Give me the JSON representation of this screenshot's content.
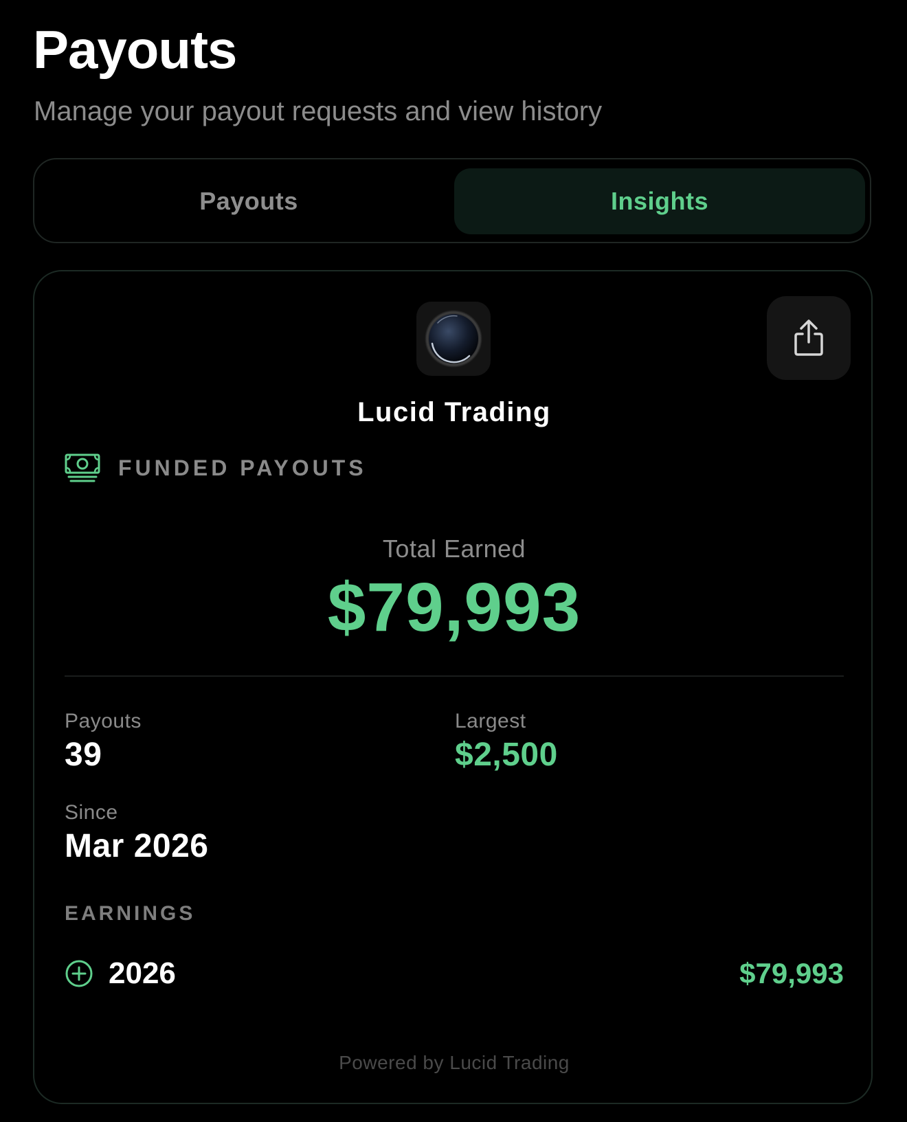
{
  "header": {
    "title": "Payouts",
    "subtitle": "Manage your payout requests and view history"
  },
  "tabs": [
    {
      "label": "Payouts",
      "active": false
    },
    {
      "label": "Insights",
      "active": true
    }
  ],
  "card": {
    "logo_icon": "moon-orb-logo",
    "share_icon": "share-icon",
    "brand_name": "Lucid Trading",
    "section_icon": "cash-stack-icon",
    "section_label": "FUNDED PAYOUTS",
    "total_label": "Total Earned",
    "total_value": "$79,993",
    "stats": {
      "payouts": {
        "label": "Payouts",
        "value": "39"
      },
      "largest": {
        "label": "Largest",
        "value": "$2,500"
      },
      "since": {
        "label": "Since",
        "value": "Mar 2026"
      }
    },
    "earnings": {
      "title": "EARNINGS",
      "rows": [
        {
          "icon": "plus-circle-icon",
          "year": "2026",
          "amount": "$79,993"
        }
      ]
    },
    "footer": "Powered by Lucid Trading"
  },
  "colors": {
    "background": "#000000",
    "accent_green": "#5fcf8c",
    "active_tab_bg": "#0c1a15",
    "muted_text": "#8a8a8a",
    "card_border": "#1c2a24"
  }
}
